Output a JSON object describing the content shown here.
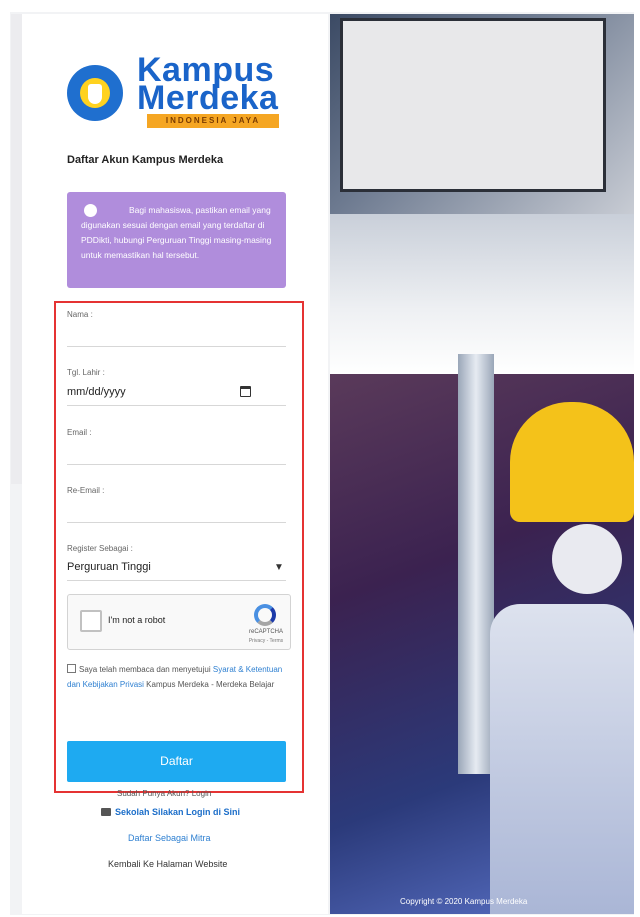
{
  "logo": {
    "line1": "Kampus",
    "line2": "Merdeka",
    "tagline": "INDONESIA JAYA"
  },
  "page_title": "Daftar Akun Kampus Merdeka",
  "notice": {
    "text": "Bagi mahasiswa, pastikan email yang digunakan sesuai dengan email yang terdaftar di PDDikti, hubungi Perguruan Tinggi masing-masing untuk memastikan hal tersebut."
  },
  "form": {
    "nama_label": "Nama :",
    "tgl_lahir_label": "Tgl. Lahir :",
    "tgl_lahir_placeholder": "mm/dd/yyyy",
    "email_label": "Email :",
    "re_email_label": "Re-Email :",
    "register_label": "Register Sebagai :",
    "register_value": "Perguruan Tinggi"
  },
  "captcha": {
    "label": "I'm not a robot",
    "brand": "reCAPTCHA",
    "links": "Privacy - Terms"
  },
  "terms": {
    "prefix": "Saya telah membaca dan menyetujui",
    "link": "Syarat & Ketentuan dan Kebijakan Privasi",
    "suffix": "Kampus Merdeka - Merdeka Belajar"
  },
  "submit_label": "Daftar",
  "links": {
    "have_account": "Sudah Punya Akun? Login",
    "login_here": "Sekolah Silakan Login di Sini",
    "partner_register": "Daftar Sebagai Mitra",
    "back_to_site": "Kembali Ke Halaman Website"
  },
  "copyright": "Copyright © 2020 Kampus Merdeka",
  "colors": {
    "primary": "#1eaaf1",
    "notice_bg": "#b08ddc",
    "highlight_border": "#e53333",
    "link": "#2f80d1"
  }
}
